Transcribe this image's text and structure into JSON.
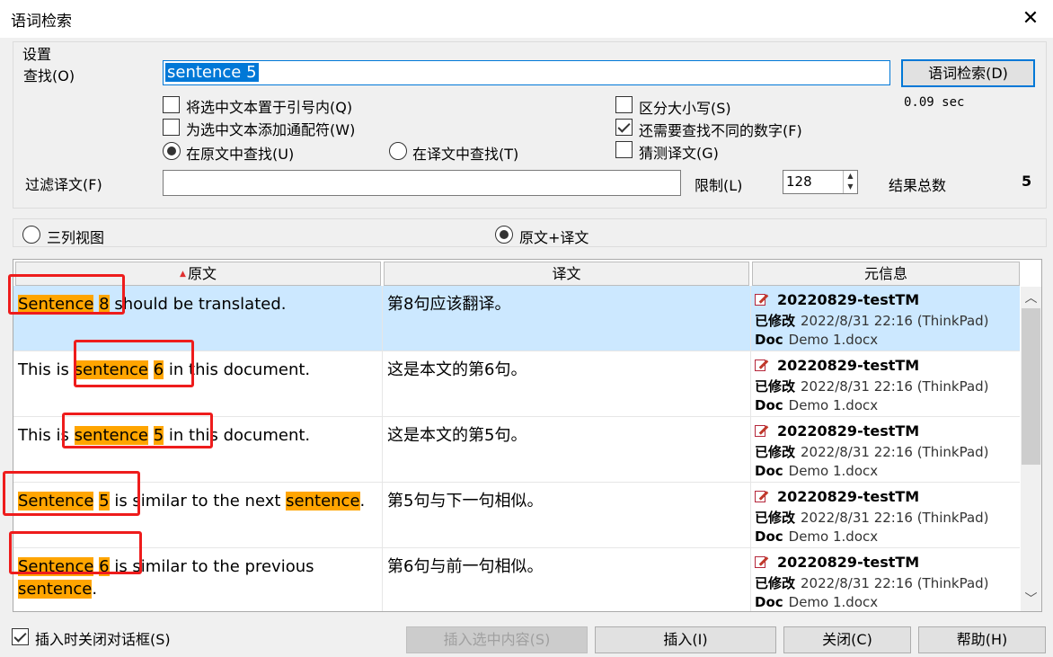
{
  "window": {
    "title": "语词检索",
    "close_glyph": "✕"
  },
  "settings": {
    "group_label": "设置",
    "find_label": "查找(O)",
    "find_value": "sentence 5",
    "search_button": "语词检索(D)",
    "time_label": "0.09 sec",
    "options_left": [
      {
        "label": "将选中文本置于引号内(Q)",
        "checked": false
      },
      {
        "label": "为选中文本添加通配符(W)",
        "checked": false
      }
    ],
    "radio_source": "在原文中查找(U)",
    "radio_target": "在译文中查找(T)",
    "options_right": [
      {
        "label": "区分大小写(S)",
        "checked": false
      },
      {
        "label": "还需要查找不同的数字(F)",
        "checked": true
      },
      {
        "label": "猜测译文(G)",
        "checked": false
      }
    ],
    "filter_label": "过滤译文(F)",
    "limit_label": "限制(L)",
    "limit_value": "128",
    "total_label": "结果总数",
    "total_value": "5"
  },
  "view": {
    "three_column": "三列视图",
    "source_target": "原文+译文"
  },
  "grid": {
    "headers": {
      "source": "原文",
      "target": "译文",
      "meta": "元信息"
    },
    "rows": [
      {
        "source": [
          {
            "t": "Sentence",
            "h": true
          },
          {
            "t": " ",
            "h": false
          },
          {
            "t": "8",
            "h": true
          },
          {
            "t": " should be translated.",
            "h": false
          }
        ],
        "target": "第8句应该翻译。",
        "tm": "20220829-testTM",
        "modified_label": "已修改",
        "modified_value": "2022/8/31 22:16 (ThinkPad)",
        "doc_label": "Doc",
        "doc_value": "Demo 1.docx"
      },
      {
        "source": [
          {
            "t": "This is ",
            "h": false
          },
          {
            "t": "sentence",
            "h": true
          },
          {
            "t": " ",
            "h": false
          },
          {
            "t": "6",
            "h": true
          },
          {
            "t": " in this document.",
            "h": false
          }
        ],
        "target": "这是本文的第6句。",
        "tm": "20220829-testTM",
        "modified_label": "已修改",
        "modified_value": "2022/8/31 22:16 (ThinkPad)",
        "doc_label": "Doc",
        "doc_value": "Demo 1.docx"
      },
      {
        "source": [
          {
            "t": "This is ",
            "h": false
          },
          {
            "t": "sentence",
            "h": true
          },
          {
            "t": " ",
            "h": false
          },
          {
            "t": "5",
            "h": true
          },
          {
            "t": " in this document.",
            "h": false
          }
        ],
        "target": "这是本文的第5句。",
        "tm": "20220829-testTM",
        "modified_label": "已修改",
        "modified_value": "2022/8/31 22:16 (ThinkPad)",
        "doc_label": "Doc",
        "doc_value": "Demo 1.docx"
      },
      {
        "source": [
          {
            "t": "Sentence",
            "h": true
          },
          {
            "t": " ",
            "h": false
          },
          {
            "t": "5",
            "h": true
          },
          {
            "t": " is similar to the next ",
            "h": false
          },
          {
            "t": "sentence",
            "h": true
          },
          {
            "t": ".",
            "h": false
          }
        ],
        "target": "第5句与下一句相似。",
        "tm": "20220829-testTM",
        "modified_label": "已修改",
        "modified_value": "2022/8/31 22:16 (ThinkPad)",
        "doc_label": "Doc",
        "doc_value": "Demo 1.docx"
      },
      {
        "source": [
          {
            "t": "Sentence",
            "h": true
          },
          {
            "t": " ",
            "h": false
          },
          {
            "t": "6",
            "h": true
          },
          {
            "t": " is similar to the previous ",
            "h": false
          },
          {
            "t": "sentence",
            "h": true
          },
          {
            "t": ".",
            "h": false
          }
        ],
        "target": "第6句与前一句相似。",
        "tm": "20220829-testTM",
        "modified_label": "已修改",
        "modified_value": "2022/8/31 22:16 (ThinkPad)",
        "doc_label": "Doc",
        "doc_value": "Demo 1.docx"
      }
    ]
  },
  "footer": {
    "close_on_insert": "插入时关闭对话框(S)",
    "close_on_insert_checked": true,
    "insert_selected": "插入选中内容(S)",
    "insert": "插入(I)",
    "close": "关闭(C)",
    "help": "帮助(H)"
  },
  "colors": {
    "highlight": "#ffa500",
    "selected_row": "#cce8ff",
    "annotation_box": "#ee1c1c",
    "accent": "#0078d7"
  }
}
